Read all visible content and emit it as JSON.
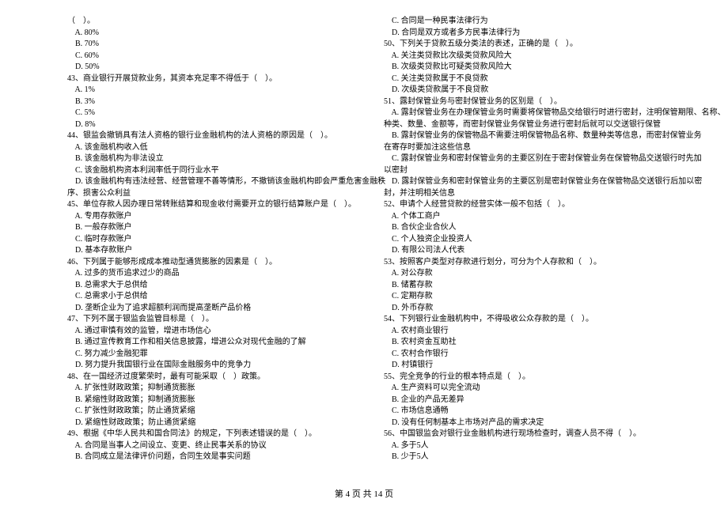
{
  "left_lines": [
    "（    ）。",
    "    A. 80%",
    "    B. 70%",
    "    C. 60%",
    "    D. 50%",
    "43、商业银行开展贷款业务，其资本充足率不得低于（    ）。",
    "    A. 1%",
    "    B. 3%",
    "    C. 5%",
    "    D. 8%",
    "44、银监会撤销具有法人资格的银行业金融机构的法人资格的原因是（    ）。",
    "    A. 该金融机构收入低",
    "    B. 该金融机构为非法设立",
    "    C. 该金融机构资本利润率低于同行业水平",
    "    D. 该金融机构有违法经营、经营管理不善等情形，不撤销该金融机构即会严重危害金融秩",
    "序、损害公众利益",
    "45、单位存款人因办理日常转账结算和现金收付需要开立的银行结算账户是（    ）。",
    "    A. 专用存款账户",
    "    B. 一般存款账户",
    "    C. 临时存款账户",
    "    D. 基本存款账户",
    "46、下列属于能够形成成本推动型通货膨胀的因素是（    ）。",
    "    A. 过多的货币追求过少的商品",
    "    B. 总需求大于总供给",
    "    C. 总需求小于总供给",
    "    D. 垄断企业为了追求超额利润而提高垄断产品价格",
    "47、下列不属于银监会监管目标是（    ）。",
    "    A. 通过审慎有效的监管，增进市场信心",
    "    B. 通过宣传教育工作和相关信息披露，增进公众对现代金融的了解",
    "    C. 努力减少金融犯罪",
    "    D. 努力提升我国银行业在国际金融服务中的竞争力",
    "48、在一国经济过度繁荣时，最有可能采取（    ）政策。",
    "    A. 扩张性财政政策；抑制通货膨胀",
    "    B. 紧缩性财政政策；抑制通货膨胀",
    "    C. 扩张性财政政策；防止通货紧缩",
    "    D. 紧缩性财政政策；防止通货紧缩",
    "49、根据《中华人民共和国合同法》的规定，下列表述错误的是（    ）。",
    "    A. 合同是当事人之间设立、变更、终止民事关系的协议",
    "    B. 合同成立是法律评价问题，合同生效是事实问题"
  ],
  "right_lines": [
    "    C. 合同是一种民事法律行为",
    "    D. 合同是双方或者多方民事法律行为",
    "50、下列关于贷款五级分类法的表述，正确的是（    ）。",
    "    A. 关注类贷款比次级类贷款风险大",
    "    B. 次级类贷款比可疑类贷款风险大",
    "    C. 关注类贷款属于不良贷款",
    "    D. 次级类贷款属于不良贷款",
    "51、露封保管业务与密封保管业务的区别是（    ）。",
    "    A. 露封保管业务在办理保管业务时需要将保管物品交给银行时进行密封，注明保管期限、名称、",
    "种类、数量、金额等，而密封保管业务保管业务进行密封后就可以交送银行保管",
    "    B. 露封保管业务的保管物品不需要注明保管物品名称、数量种类等信息，而密封保管业务",
    "在寄存时要加注这些信息",
    "    C. 露封保管业务和密封保管业务的主要区别在于密封保管业务在保管物品交送银行时先加",
    "以密封",
    "    D. 露封保管业务和密封保管业务的主要区别是密封保管业务在保管物品交送银行后加以密",
    "封，并注明相关信息",
    "52、申请个人经营贷款的经营实体一般不包括（    ）。",
    "    A. 个体工商户",
    "    B. 合伙企业合伙人",
    "    C. 个人独资企业投资人",
    "    D. 有限公司法人代表",
    "53、按照客户类型对存款进行划分，可分为个人存款和（    ）。",
    "    A. 对公存款",
    "    B. 储蓄存款",
    "    C. 定期存款",
    "    D. 外币存款",
    "54、下列银行业金融机构中，不得吸收公众存款的是（    ）。",
    "    A. 农村商业银行",
    "    B. 农村资金互助社",
    "    C. 农村合作银行",
    "    D. 村镇银行",
    "55、完全竞争的行业的根本特点是（    ）。",
    "    A. 生产资料可以完全流动",
    "    B. 企业的产品无差异",
    "    C. 市场信息通畅",
    "    D. 没有任何制基本上市场对产品的需求决定",
    "56、中国银监会对银行业金融机构进行现场检查时，调查人员不得（    ）。",
    "    A. 多于5人",
    "    B. 少于5人"
  ],
  "footer": "第 4 页 共 14 页"
}
